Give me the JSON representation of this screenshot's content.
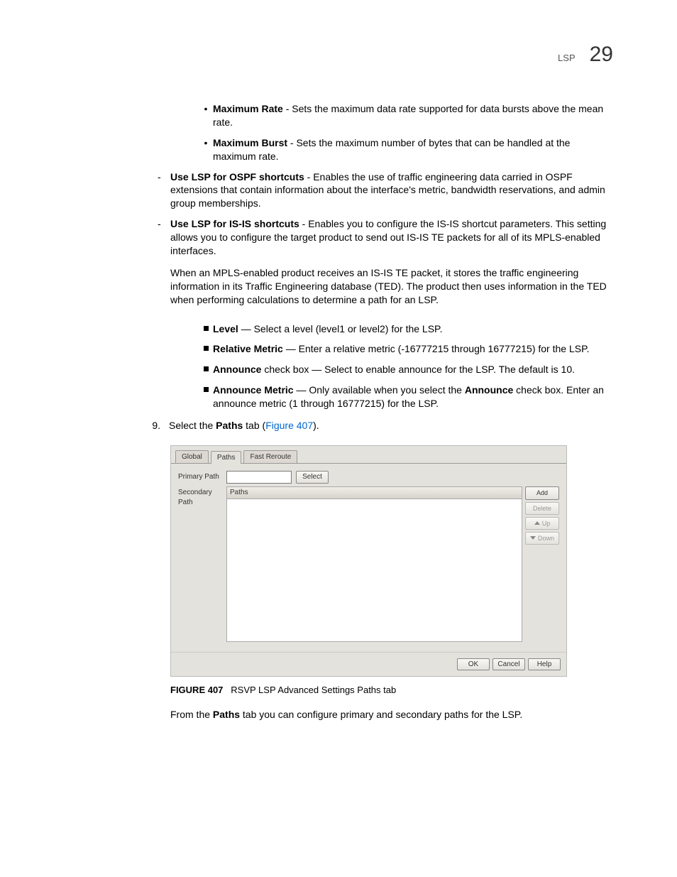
{
  "header": {
    "section": "LSP",
    "chapter": "29"
  },
  "bullets": {
    "max_rate_term": "Maximum Rate",
    "max_rate_text": " - Sets the maximum data rate supported for data bursts above the mean rate.",
    "max_burst_term": "Maximum Burst",
    "max_burst_text": " - Sets the maximum number of bytes that can be handled at the maximum rate.",
    "ospf_term": "Use LSP for OSPF shortcuts",
    "ospf_text": " - Enables the use of traffic engineering data carried in OSPF extensions that contain information about the interface's metric, bandwidth reservations, and admin group memberships.",
    "isis_term": "Use LSP for IS-IS shortcuts",
    "isis_text": " - Enables you to configure the IS-IS shortcut parameters. This setting allows you to configure the target product to send out IS-IS TE packets for all of its MPLS-enabled interfaces.",
    "isis_para": "When an MPLS-enabled product receives an IS-IS TE packet, it stores the traffic engineering information in its Traffic Engineering database (TED). The product then uses information in the TED when performing calculations to determine a path for an LSP.",
    "level_term": "Level",
    "level_text": " — Select a level (level1 or level2) for the LSP.",
    "relmetric_term": "Relative Metric",
    "relmetric_text": " — Enter a relative metric (-16777215 through 16777215) for the LSP.",
    "announce_term": "Announce",
    "announce_text": " check box — Select to enable announce for the LSP. The default is 10.",
    "annmetric_term": "Announce Metric",
    "annmetric_mid": " — Only available when you select the ",
    "annmetric_bold2": "Announce",
    "annmetric_tail": " check box. Enter an announce metric (1 through 16777215) for the LSP."
  },
  "step9": {
    "num": "9.",
    "pre": "Select the ",
    "bold": "Paths",
    "mid": " tab (",
    "link": "Figure 407",
    "post": ")."
  },
  "dialog": {
    "tabs": {
      "global": "Global",
      "paths": "Paths",
      "fast_reroute": "Fast Reroute"
    },
    "primary_label": "Primary Path",
    "secondary_label": "Secondary Path",
    "select": "Select",
    "paths_col": "Paths",
    "add": "Add",
    "delete": "Delete",
    "up": "Up",
    "down": "Down",
    "ok": "OK",
    "cancel": "Cancel",
    "help": "Help"
  },
  "figcap": {
    "label": "FIGURE 407",
    "text": "RSVP LSP Advanced Settings Paths tab"
  },
  "closing": {
    "pre": "From the ",
    "bold": "Paths",
    "post": " tab you can configure primary and secondary paths for the LSP."
  }
}
